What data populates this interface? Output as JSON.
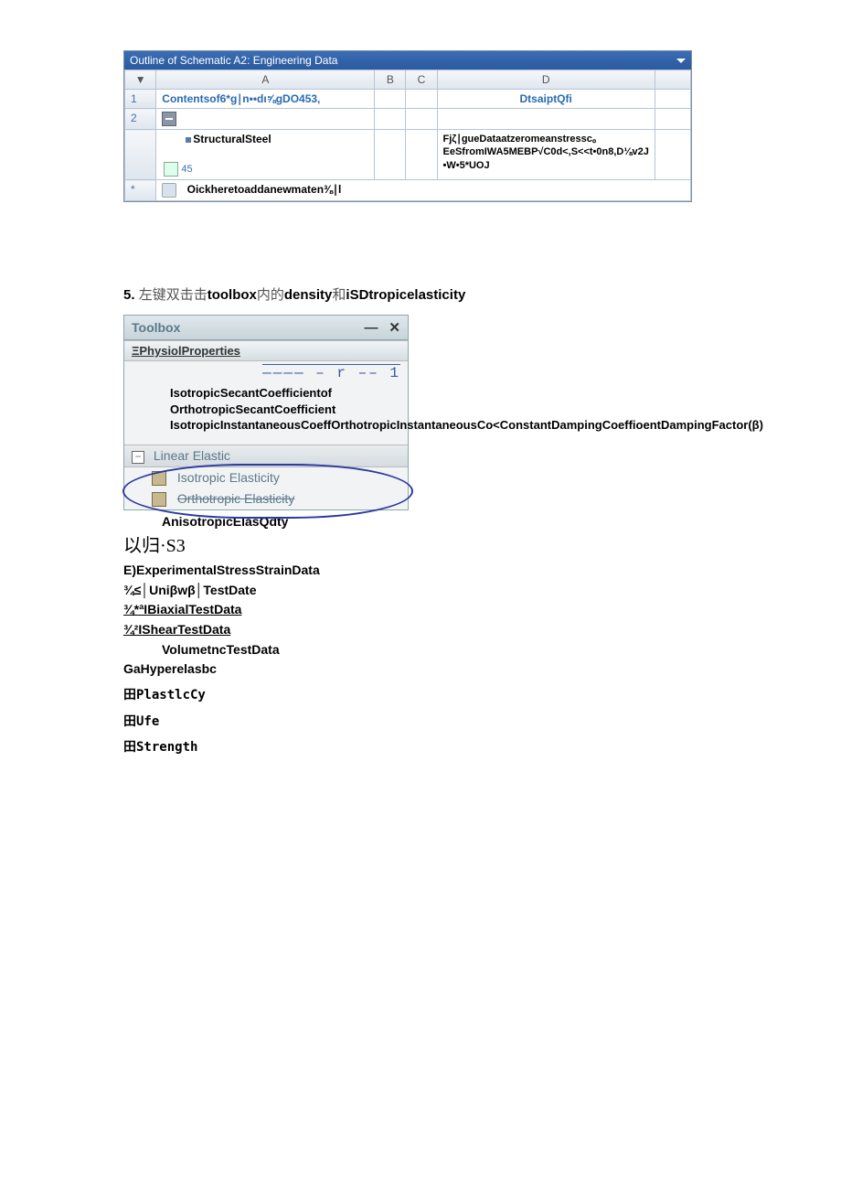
{
  "outline": {
    "title": "Outline of Schematic A2: Engineering Data",
    "cols": {
      "a": "A",
      "b": "B",
      "c": "C",
      "d": "D",
      "arrow": "▼"
    },
    "row1": {
      "num": "1",
      "a": "Contentsof6*g∣n••dι⅝gDO453,",
      "d": "DtsaiptQfi"
    },
    "row2": {
      "num": "2"
    },
    "structural": {
      "label": "StructuralSteel",
      "desc": "Fjζ∣gueDataatzeromeanstressc。EeSfromIWA5MEBP√C0d<,S<<t•0n8,D⅛v2J •W•5*UOJ",
      "badge": "45"
    },
    "addrow": {
      "star": "*",
      "label": "Oickheretoaddanewmaten⅜∣l"
    }
  },
  "step": {
    "num": "5.",
    "pre": "左键双击击",
    "t1": "toolbox",
    "mid": "内的",
    "t2": "density",
    "and": "和",
    "t3": "iSDtropicelasticity"
  },
  "toolbox": {
    "title": "Toolbox",
    "min": "—",
    "close": "✕",
    "physical_header": "ΞPhysiolProperties",
    "placeholder_line": "———— – r –– 1",
    "phys_items": "IsotropicSecantCoefficientof OrthotropicSecantCoefficient IsotropicInstantaneousCoeffOrthotropicInstantaneousCo<ConstantDampingCoeffioentDampingFactor(β)",
    "linear_header": "Linear Elastic",
    "iso": "Isotropic Elasticity",
    "ortho": "Orthotropic Elasticity",
    "aniso": "AnisotropicElasQdty"
  },
  "below": {
    "l1": "以归·S3",
    "l2": "E)ExperimentalStressStrainData",
    "l3": "¾≤│Uniβwβ│TestDate",
    "l4": "¾*ªIBiaxialTestData",
    "l5": "¾²IShearTestData",
    "l6": "VolumetncTestData",
    "l7": "GaHyperelasbc",
    "l8": "田PlastlcCy",
    "l9": "田Ufe",
    "l10": "田Strength"
  }
}
